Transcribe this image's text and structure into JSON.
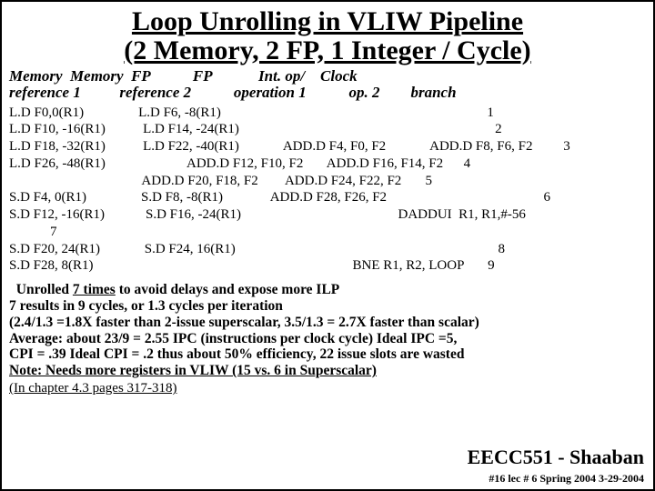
{
  "title_line1": "Loop Unrolling in VLIW Pipeline",
  "title_line2": "(2 Memory, 2 FP, 1 Integer / Cycle)",
  "hdr_line1": "Memory  Memory  FP           FP            Int. op/    Clock",
  "hdr_line2": "reference 1          reference 2           operation 1           op. 2        branch",
  "body_lines": [
    "L.D F0,0(R1)                L.D F6, -8(R1)                                                                              1",
    "L.D F10, -16(R1)           L.D F14, -24(R1)                                                                           2",
    "L.D F18, -32(R1)           L.D F22, -40(R1)             ADD.D F4, F0, F2             ADD.D F8, F6, F2         3",
    "L.D F26, -48(R1)                        ADD.D F12, F10, F2       ADD.D F16, F14, F2      4",
    "                                       ADD.D F20, F18, F2        ADD.D F24, F22, F2       5",
    "S.D F4, 0(R1)                S.D F8, -8(R1)              ADD.D F28, F26, F2                                              6",
    "S.D F12, -16(R1)            S.D F16, -24(R1)                                              DADDUI  R1, R1,#-56\n            7",
    "S.D F20, 24(R1)             S.D F24, 16(R1)                                                                             8",
    "S.D F28, 8(R1)                                                                            BNE R1, R2, LOOP       9"
  ],
  "note_unrolled_pre": "Unrolled ",
  "note_unrolled_mid": "7 times",
  "note_unrolled_post": " to avoid delays and expose more ILP",
  "note2": "   7 results in 9 cycles, or 1.3 cycles per iteration",
  "note3": " (2.4/1.3 =1.8X faster than 2-issue superscalar,  3.5/1.3 = 2.7X faster than scalar)",
  "note4": " Average: about 23/9 = 2.55 IPC  (instructions per clock cycle)   Ideal IPC =5,",
  "note5": "   CPI = .39   Ideal CPI = .2   thus about 50% efficiency, 22 issue slots are wasted",
  "note6": "   Note: Needs more registers in VLIW (15 vs. 6 in Superscalar)",
  "chapter_ref": "(In chapter 4.3 pages 317-318)",
  "footer_course": "EECC551 - Shaaban",
  "footer_sub": "#16  lec # 6   Spring 2004   3-29-2004"
}
